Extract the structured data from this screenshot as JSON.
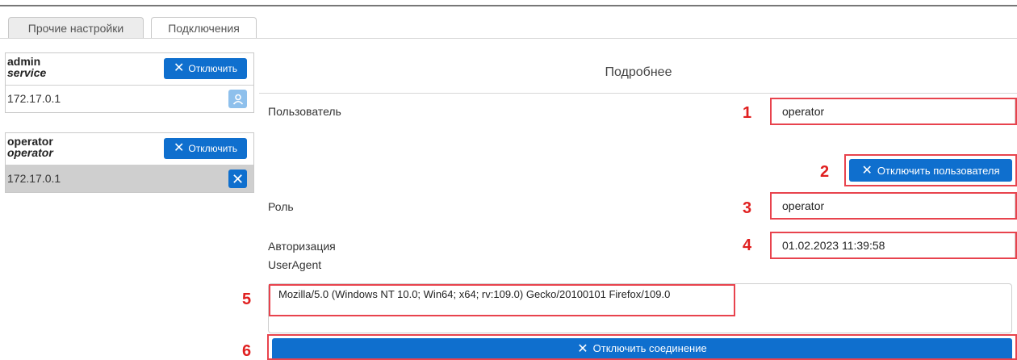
{
  "tabs": [
    {
      "label": "Прочие настройки"
    },
    {
      "label": "Подключения"
    }
  ],
  "connections": [
    {
      "user": "admin",
      "role": "service",
      "ip": "172.17.0.1",
      "disconnect_label": "Отключить",
      "row_icon": "user-icon"
    },
    {
      "user": "operator",
      "role": "operator",
      "ip": "172.17.0.1",
      "disconnect_label": "Отключить",
      "row_icon": "close-icon"
    }
  ],
  "details": {
    "title": "Подробнее",
    "user_label": "Пользователь",
    "user_value": "operator",
    "disconnect_user_label": "Отключить пользователя",
    "role_label": "Роль",
    "role_value": "operator",
    "auth_label": "Авторизация",
    "auth_value": "01.02.2023 11:39:58",
    "useragent_label": "UserAgent",
    "useragent_value": "Mozilla/5.0 (Windows NT 10.0; Win64; x64; rv:109.0) Gecko/20100101 Firefox/109.0",
    "disconnect_connection_label": "Отключить соединение"
  },
  "annotations": [
    "1",
    "2",
    "3",
    "4",
    "5",
    "6"
  ],
  "colors": {
    "accent": "#0f6fce",
    "highlight": "#e8434d",
    "annotation": "#e02020"
  }
}
